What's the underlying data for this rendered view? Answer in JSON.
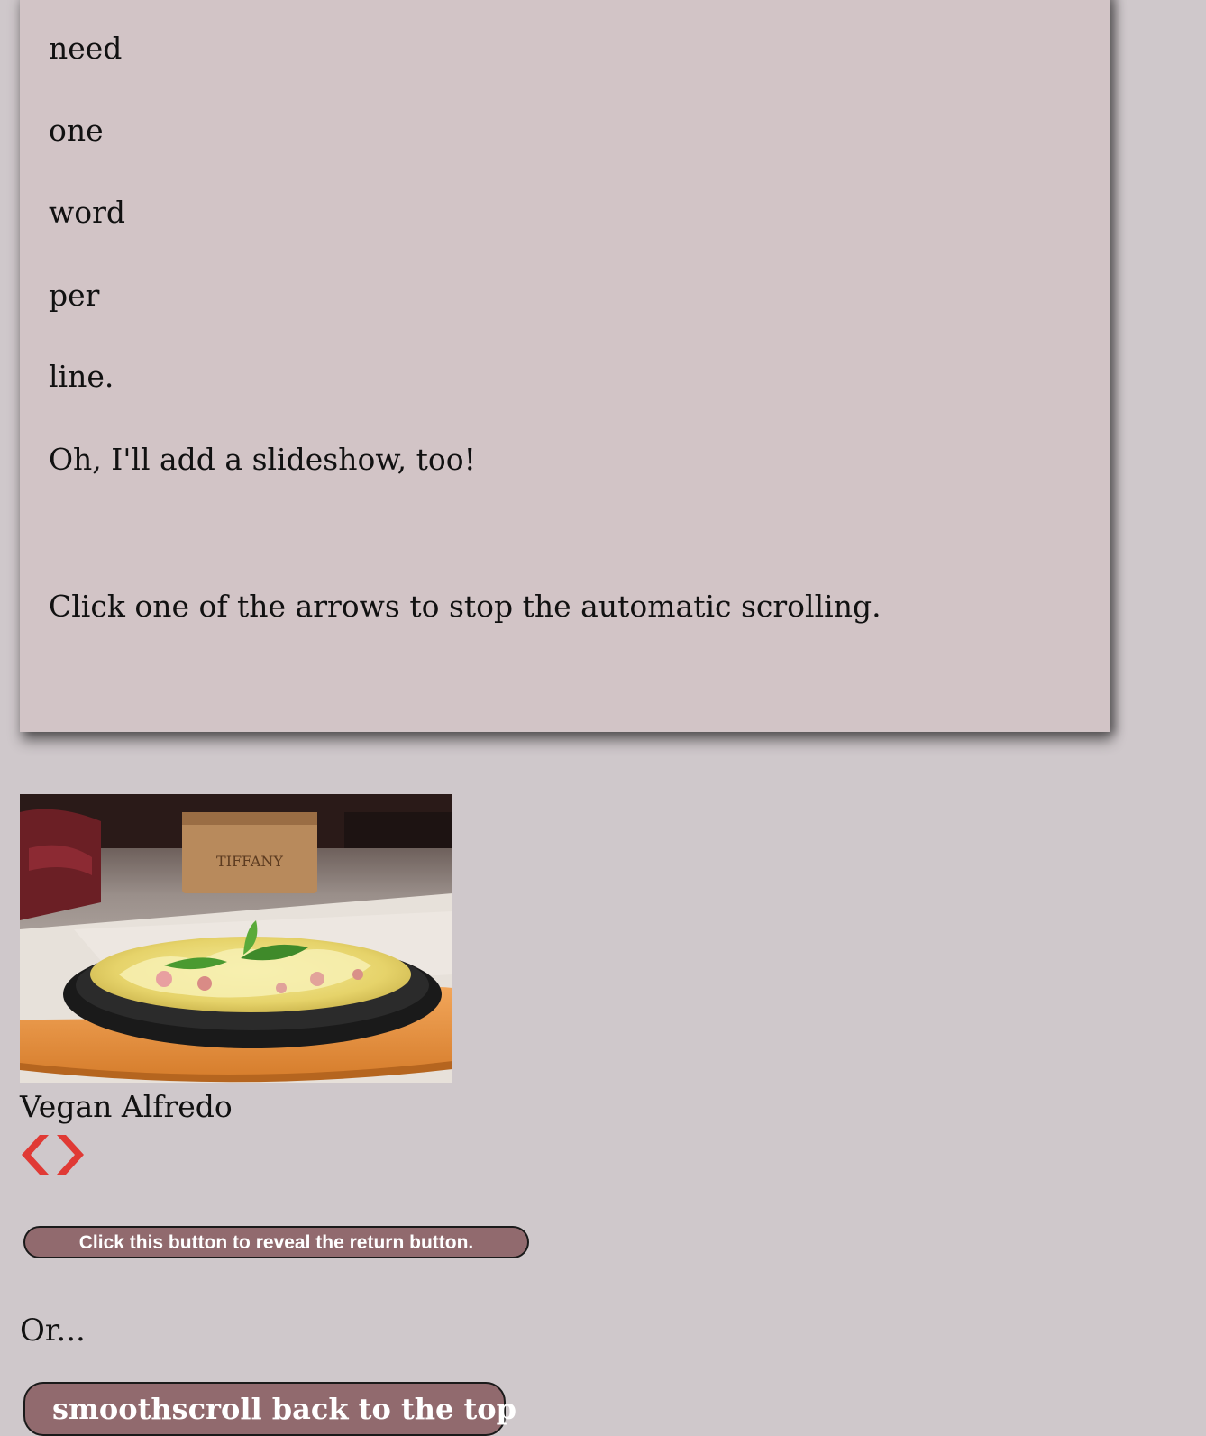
{
  "article": {
    "lines": [
      "need",
      "one",
      "word",
      "per",
      "line."
    ],
    "slideshow_note": "Oh, I'll add a slideshow, too!",
    "instruction": "Click one of the arrows to stop the automatic scrolling."
  },
  "slideshow": {
    "caption": "Vegan Alfredo",
    "prev_icon": "chevron-left-icon",
    "next_icon": "chevron-right-icon",
    "arrow_color": "#e03a35",
    "crate_label": "TIFFANY"
  },
  "buttons": {
    "reveal_label": "Click this button to reveal the return button.",
    "or_text": "Or...",
    "scroll_label": "smoothscroll back to the top"
  },
  "colors": {
    "page_bg": "#cfc8cb",
    "card_bg": "#d2c4c6",
    "button_bg": "#916a6e"
  }
}
